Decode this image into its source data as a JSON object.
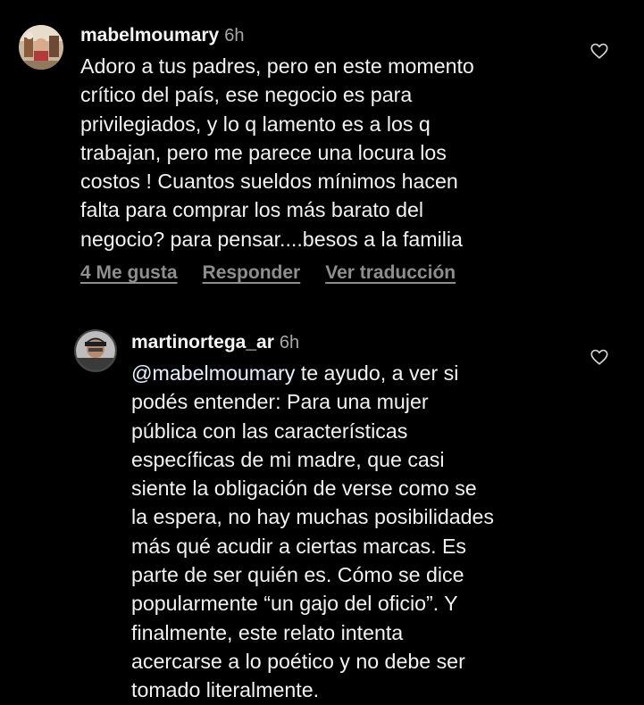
{
  "comments": [
    {
      "username": "mabelmoumary",
      "time": "6h",
      "text": "Adoro a tus padres, pero en este momento\ncrítico del país, ese negocio es para\nprivilegiados,  y lo q lamento es a los q\ntrabajan, pero me parece una locura los\ncostos ! Cuantos sueldos mínimos hacen\nfalta para comprar los más barato del\nnegocio? para pensar....besos a la familia",
      "likes_label": "4 Me gusta",
      "reply_label": "Responder",
      "translate_label": "Ver traducción",
      "like_icon": "heart-outline-icon"
    },
    {
      "username": "martinortega_ar",
      "time": "6h",
      "mention": "@mabelmoumary",
      "text": " te ayudo, a ver si\npodés entender: Para una mujer\npública con las características\nespecíficas de mi madre, que casi\nsiente la obligación de verse como se\nla espera, no hay muchas posibilidades\nmás qué acudir a ciertas marcas. Es\nparte de ser quién es. Cómo se dice\npopularmente “un gajo del oficio”. Y\nfinalmente, este relato intenta\nacercarse a lo poético y no debe ser\ntomado literalmente.",
      "like_icon": "heart-outline-icon"
    }
  ],
  "colors": {
    "background": "#000000",
    "text": "#f5f5f5",
    "secondary": "#8e8e8e",
    "time": "#a8a8a8"
  }
}
